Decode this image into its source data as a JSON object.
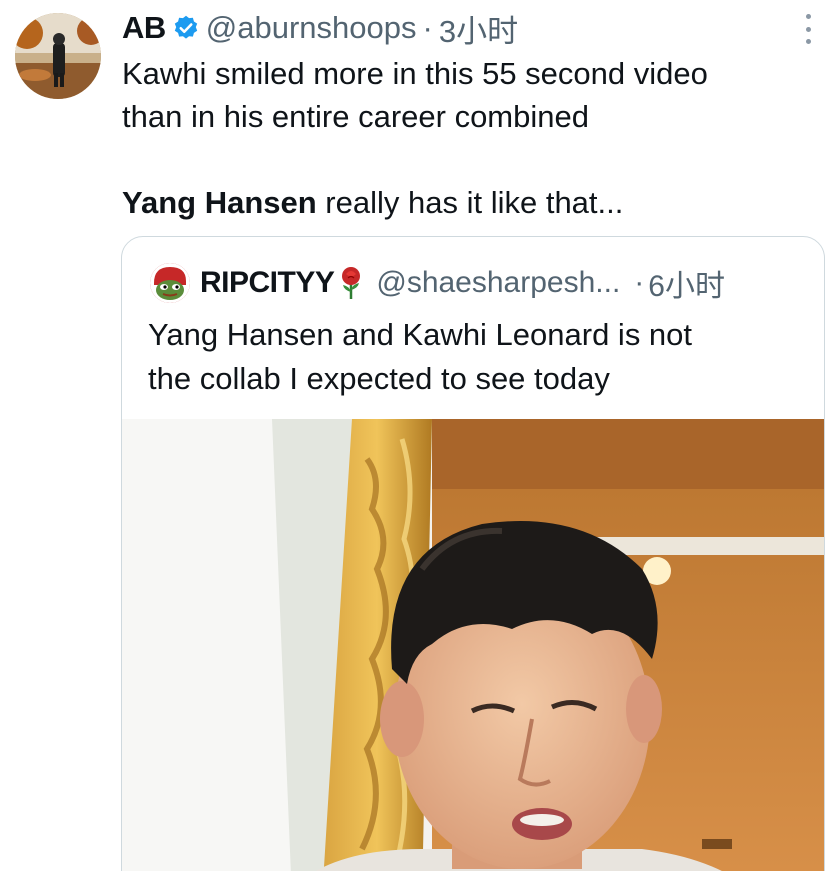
{
  "tweet": {
    "display_name": "AB",
    "handle": "@aburnshoops",
    "separator": "·",
    "time": "3小时",
    "text_line1": "Kawhi smiled more in this 55 second video",
    "text_line2": "than in his entire career combined",
    "text_bold": "Yang Hansen",
    "text_rest": " really has it like that...",
    "verified_color": "#1d9bf0"
  },
  "quote": {
    "display_name": "RIPCITYY",
    "handle": "@shaesharpesh...",
    "separator": "·",
    "time": "6小时",
    "text_line1": "Yang Hansen and Kawhi Leonard is not",
    "text_line2": "the collab I expected to see today"
  },
  "icons": {
    "verified": "verified-badge-icon",
    "more": "more-options-icon",
    "rose": "rose-emoji-icon"
  }
}
